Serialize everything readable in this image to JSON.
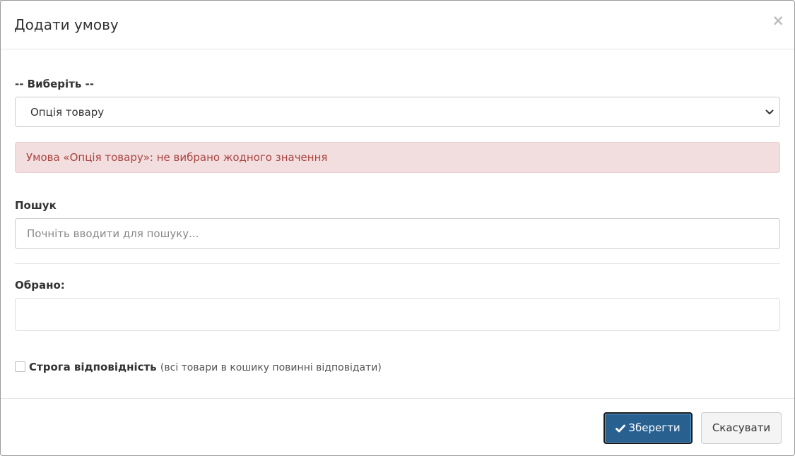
{
  "modal": {
    "title": "Додати умову",
    "close_symbol": "×"
  },
  "type_select": {
    "label": "-- Виберіть --",
    "value": "Опція товару"
  },
  "alert": {
    "message": "Умова «Опція товару»: не вибрано жодного значення"
  },
  "search": {
    "label": "Пошук",
    "placeholder": "Почніть вводити для пошуку..."
  },
  "selected": {
    "label": "Обрано:"
  },
  "strict": {
    "label": "Строга відповідність",
    "note": "(всі товари в кошику повинні відповідати)",
    "checked": false
  },
  "footer": {
    "save_label": "Зберегти",
    "cancel_label": "Скасувати"
  },
  "icons": {
    "save": "check-icon",
    "select": "chevron-down-icon",
    "close": "close-icon"
  },
  "colors": {
    "primary": "#286090",
    "alert_bg": "#f2dede",
    "alert_text": "#a94442"
  }
}
